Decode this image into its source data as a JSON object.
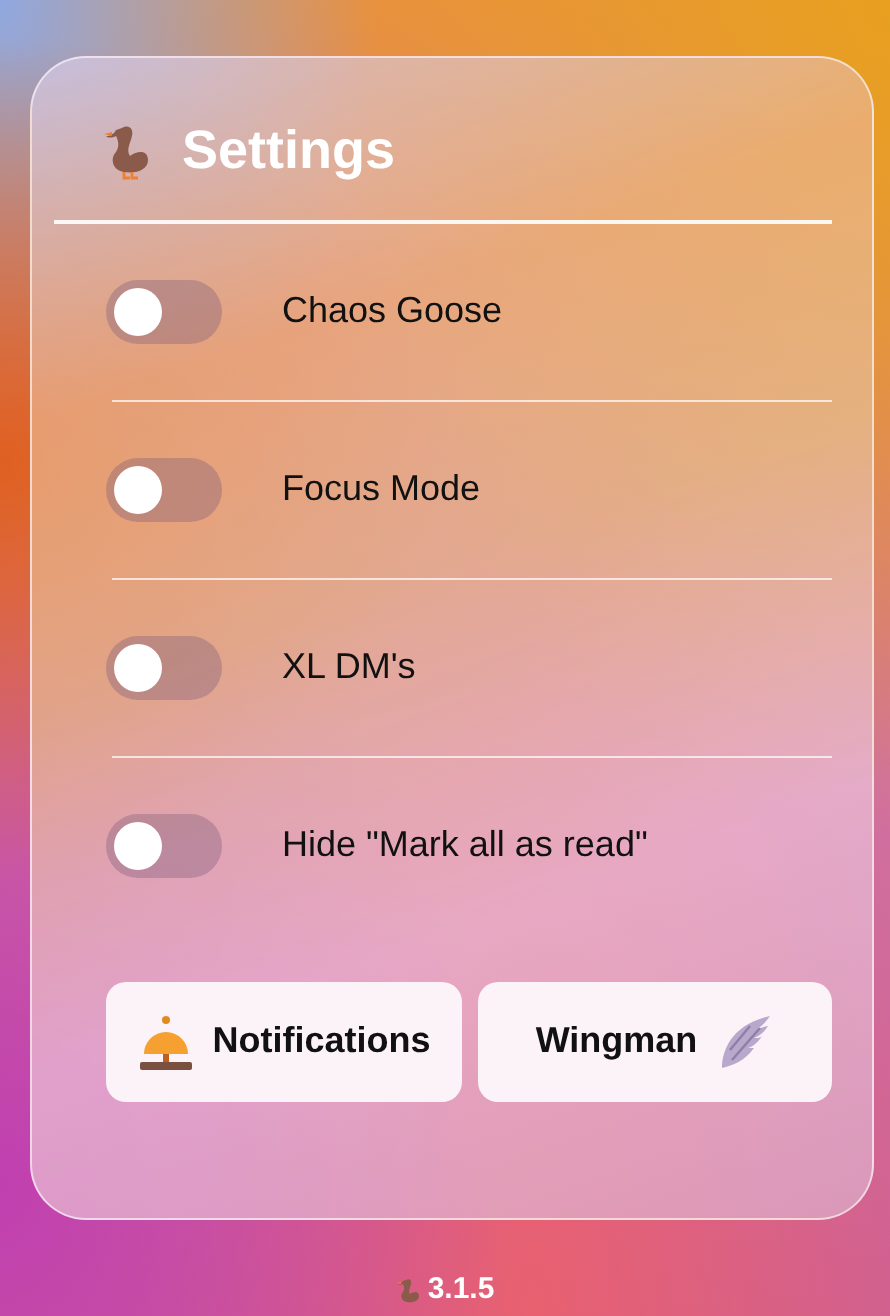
{
  "title": "Settings",
  "toggles": [
    {
      "label": "Chaos Goose",
      "on": false
    },
    {
      "label": "Focus Mode",
      "on": false
    },
    {
      "label": "XL DM's",
      "on": false
    },
    {
      "label": "Hide \"Mark all as read\"",
      "on": false
    }
  ],
  "buttons": [
    {
      "label": "Notifications",
      "kind": "bell"
    },
    {
      "label": "Wingman",
      "kind": "wing"
    }
  ],
  "version": "3.1.5"
}
